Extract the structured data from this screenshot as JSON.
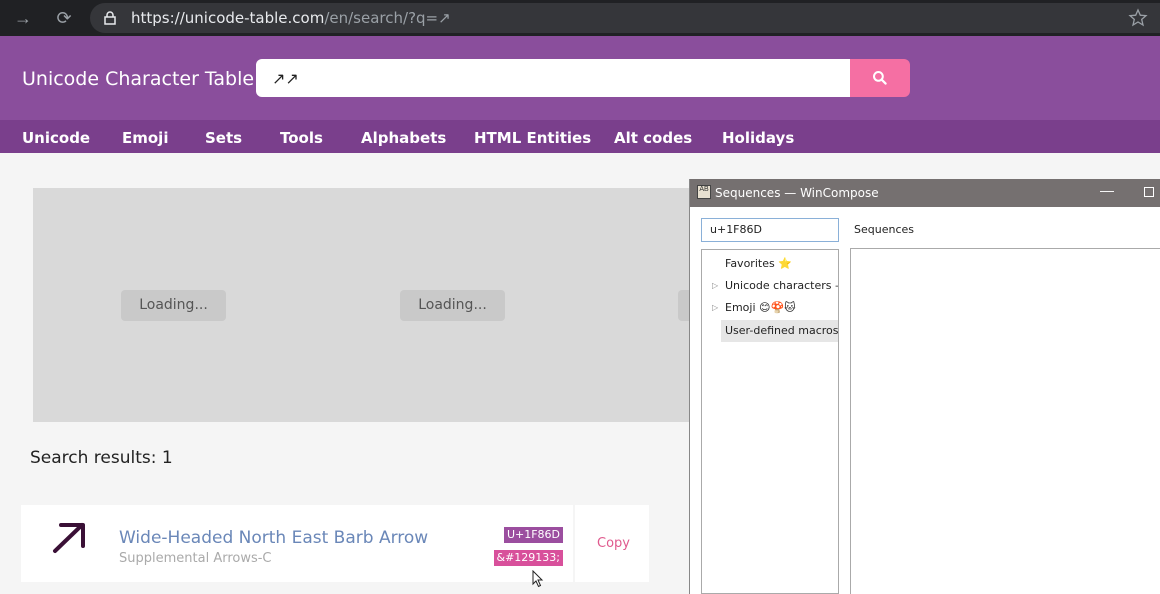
{
  "browser": {
    "url_host": "https://unicode-table.com",
    "url_path": "/en/search/?q=↗"
  },
  "site": {
    "title": "Unicode Character Table",
    "search_value": "↗↗",
    "nav": [
      "Unicode",
      "Emoji",
      "Sets",
      "Tools",
      "Alphabets",
      "HTML Entities",
      "Alt codes",
      "Holidays"
    ]
  },
  "ads": {
    "loading": [
      "Loading...",
      "Loading..."
    ]
  },
  "results": {
    "heading": "Search results: 1",
    "items": [
      {
        "name": "Wide-Headed North East Barb Arrow",
        "block": "Supplemental Arrows-C",
        "code": "U+1F86D",
        "entity": "&#129133;",
        "copy_label": "Copy"
      }
    ]
  },
  "wincompose": {
    "title": "Sequences — WinCompose",
    "logo": "ÄB",
    "search_value": "u+1F86D",
    "sequences_label": "Sequences",
    "tree": [
      {
        "label": "Favorites ⭐",
        "expandable": false
      },
      {
        "label": "Unicode characters —",
        "expandable": true
      },
      {
        "label": "Emoji 😊🍄🐱",
        "expandable": true
      },
      {
        "label": "User-defined macros (",
        "expandable": false,
        "selected": true
      }
    ]
  },
  "colors": {
    "header": "#8a4e9c",
    "nav": "#7a3f8c",
    "search_button": "#f56fa3",
    "badge_code": "#9b4e9f",
    "badge_entity": "#d8509b"
  }
}
